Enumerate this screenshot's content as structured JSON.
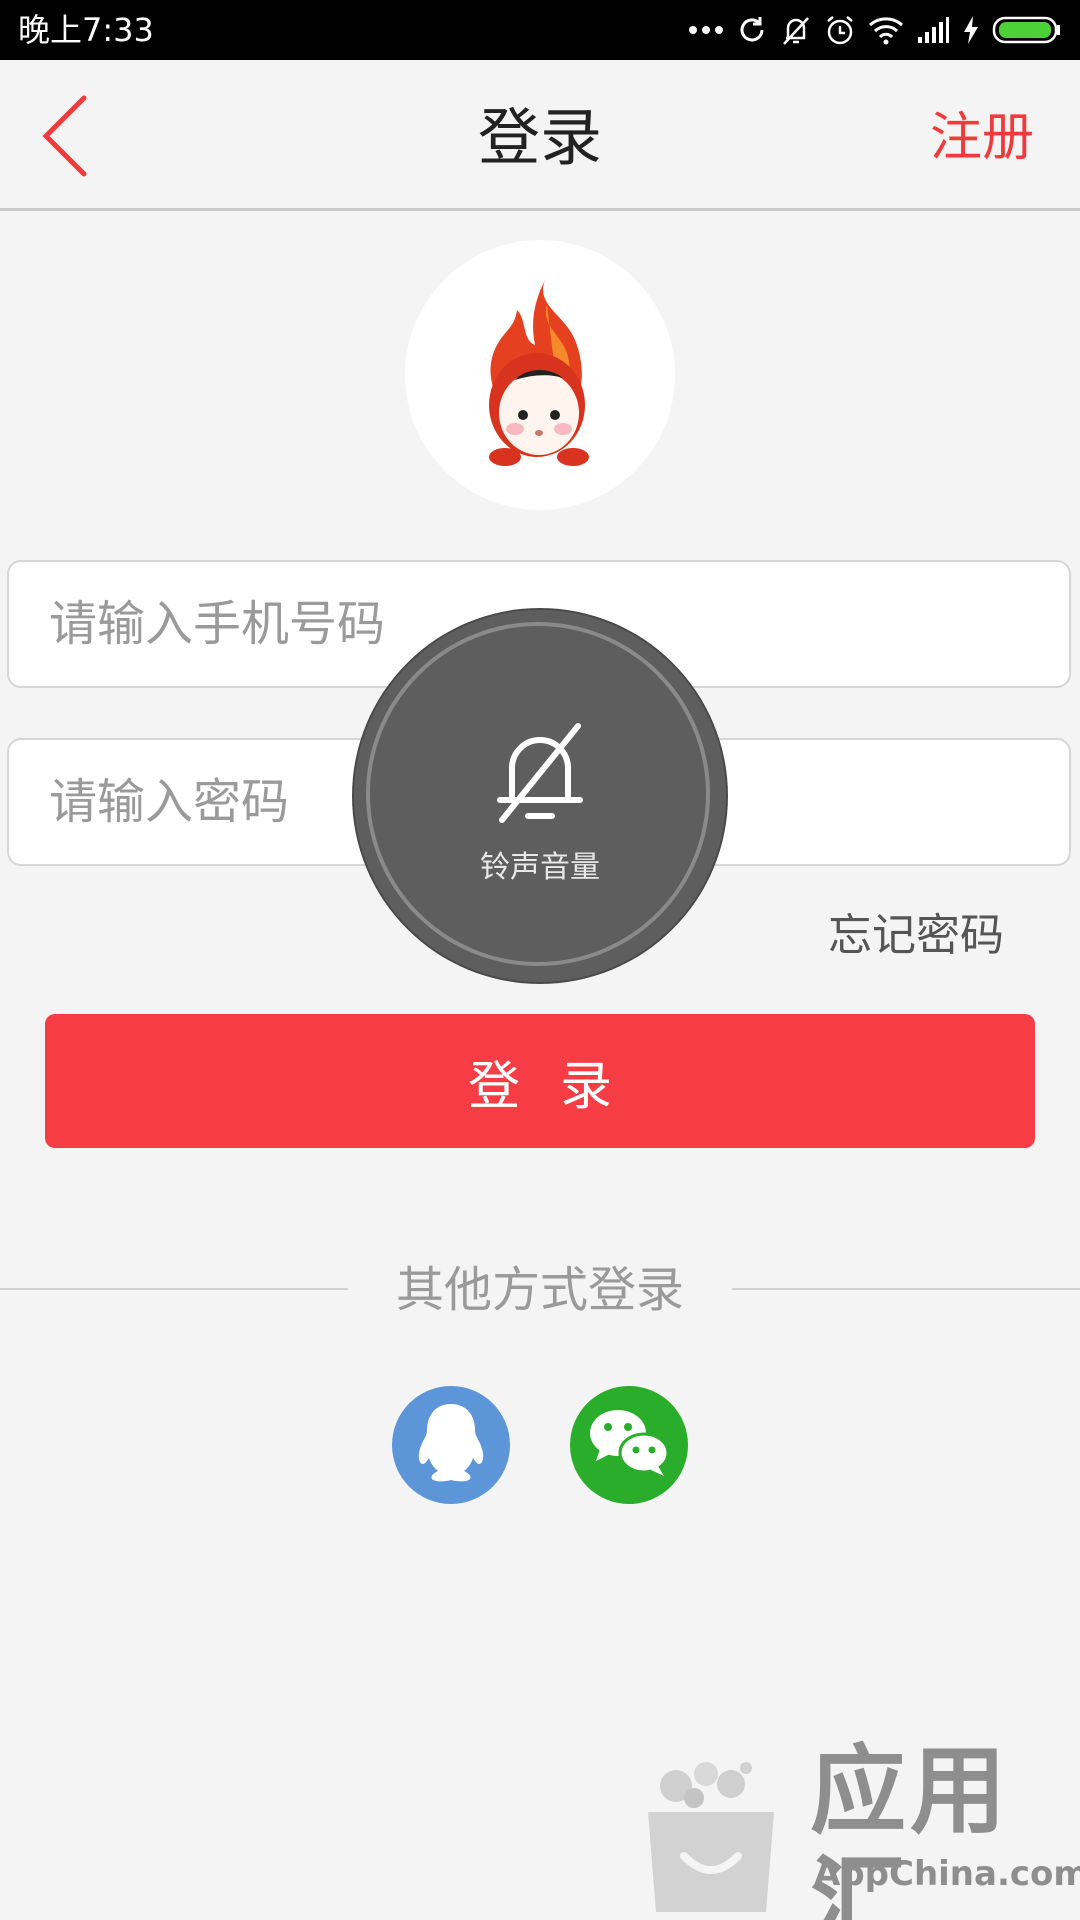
{
  "status_bar": {
    "time": "晚上7:33",
    "icons": [
      "more-dots-icon",
      "sync-icon",
      "bell-off-icon",
      "alarm-icon",
      "wifi-icon",
      "signal-icon",
      "charging-icon",
      "battery-icon"
    ]
  },
  "nav": {
    "back_icon": "chevron-left-icon",
    "title": "登录",
    "register_label": "注册"
  },
  "form": {
    "phone_placeholder": "请输入手机号码",
    "password_placeholder": "请输入密码",
    "forgot_label": "忘记密码",
    "login_label": "登录"
  },
  "other_login": {
    "label": "其他方式登录",
    "providers": [
      "qq-icon",
      "wechat-icon"
    ]
  },
  "volume_toast": {
    "label": "铃声音量",
    "icon": "bell-off-icon"
  },
  "watermark": {
    "cn": "应用汇",
    "en": "AppChina.com"
  },
  "colors": {
    "accent": "#f63c45",
    "register": "#ef3b3b",
    "qq": "#5c96d9",
    "wechat": "#2aad2a"
  }
}
